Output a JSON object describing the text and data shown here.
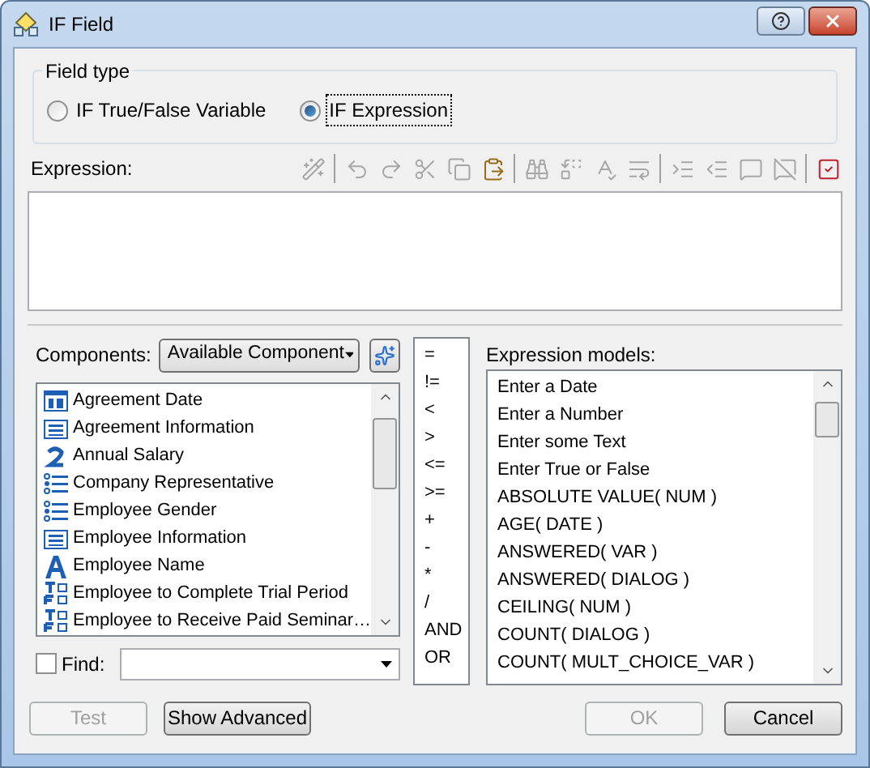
{
  "window": {
    "title": "IF Field"
  },
  "field_type": {
    "title": "Field type",
    "options": [
      {
        "label": "IF True/False Variable",
        "selected": false
      },
      {
        "label": "IF Expression",
        "selected": true
      }
    ]
  },
  "expression": {
    "label": "Expression:"
  },
  "toolbar": [
    {
      "kind": "wand",
      "disabled": true
    },
    {
      "kind": "separator"
    },
    {
      "kind": "undo",
      "disabled": true
    },
    {
      "kind": "redo",
      "disabled": true
    },
    {
      "kind": "cut",
      "disabled": true
    },
    {
      "kind": "copy",
      "disabled": true
    },
    {
      "kind": "paste",
      "disabled": false
    },
    {
      "kind": "separator"
    },
    {
      "kind": "find",
      "disabled": true
    },
    {
      "kind": "replace",
      "disabled": true
    },
    {
      "kind": "spell",
      "disabled": true
    },
    {
      "kind": "wrap",
      "disabled": true
    },
    {
      "kind": "separator"
    },
    {
      "kind": "indent",
      "disabled": true
    },
    {
      "kind": "outdent",
      "disabled": true
    },
    {
      "kind": "comment",
      "disabled": true
    },
    {
      "kind": "uncomment",
      "disabled": true
    },
    {
      "kind": "separator"
    },
    {
      "kind": "check",
      "disabled": false
    }
  ],
  "components": {
    "label": "Components:",
    "dropdown": "Available Component",
    "items": [
      {
        "kind": "date",
        "label": "Agreement Date"
      },
      {
        "kind": "text",
        "label": "Agreement Information"
      },
      {
        "kind": "number",
        "label": "Annual Salary"
      },
      {
        "kind": "choice",
        "label": "Company Representative"
      },
      {
        "kind": "choice",
        "label": "Employee Gender"
      },
      {
        "kind": "text",
        "label": "Employee Information"
      },
      {
        "kind": "name",
        "label": "Employee Name"
      },
      {
        "kind": "truefalse",
        "label": "Employee to Complete Trial Period"
      },
      {
        "kind": "truefalse",
        "label": "Employee to Receive Paid Seminar…"
      }
    ]
  },
  "operators": [
    "=",
    "!=",
    "<",
    ">",
    "<=",
    ">=",
    "+",
    "-",
    "*",
    "/",
    "AND",
    "OR"
  ],
  "models": {
    "label": "Expression models:",
    "items": [
      "Enter a Date",
      "Enter a Number",
      "Enter some Text",
      "Enter True or False",
      "ABSOLUTE VALUE( NUM )",
      "AGE( DATE )",
      "ANSWERED( VAR )",
      "ANSWERED( DIALOG )",
      "CEILING( NUM )",
      "COUNT( DIALOG )",
      "COUNT( MULT_CHOICE_VAR )"
    ]
  },
  "find": {
    "label": "Find:",
    "checked": false
  },
  "buttons": [
    {
      "label": "Test",
      "disabled": true
    },
    {
      "label": "Show Advanced",
      "disabled": false
    },
    {
      "label": "OK",
      "disabled": true
    },
    {
      "label": "Cancel",
      "disabled": false
    }
  ]
}
